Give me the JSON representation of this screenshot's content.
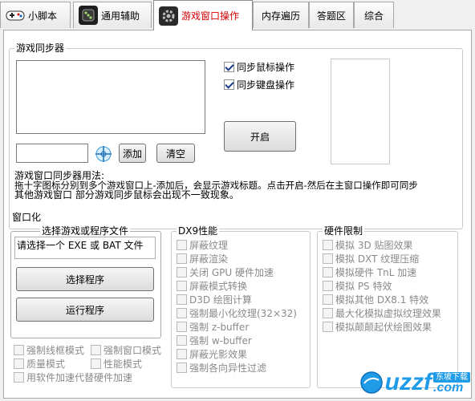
{
  "tabs": [
    {
      "label": "小脚本",
      "icon": "gamepad-icon"
    },
    {
      "label": "通用辅助",
      "icon": "dice-icon"
    },
    {
      "label": "游戏窗口操作",
      "icon": "gear-icon",
      "active": true
    },
    {
      "label": "内存遍历"
    },
    {
      "label": "答题区"
    },
    {
      "label": "综合"
    }
  ],
  "sync": {
    "title": "游戏同步器",
    "mouse_sync": "同步鼠标操作",
    "keyboard_sync": "同步键盘操作",
    "start": "开启",
    "add": "添加",
    "clear": "清空",
    "help_lines": [
      "游戏窗口同步器用法:",
      "拖十字图标分别到多个游戏窗口上-添加后，会显示游戏标题。点击开启-然后在主窗口操作即可同步",
      "其他游戏窗口        部分游戏同步鼠标会出现不一致现象。"
    ]
  },
  "windowed": {
    "title": "窗口化",
    "select_title": "选择游戏或程序文件",
    "file_text": "请选择一个 EXE 或 BAT 文件",
    "select_btn": "选择程序",
    "run_btn": "运行程序",
    "options": [
      "强制线框模式",
      "强制窗口模式",
      "质量模式",
      "性能模式",
      "用软件加速代替硬件加速"
    ]
  },
  "dx9": {
    "title": "DX9性能",
    "options": [
      "屏蔽纹理",
      "屏蔽渲染",
      "关闭 GPU 硬件加速",
      "屏蔽模式转换",
      "D3D 绘图计算",
      "强制最小化纹理(32×32)",
      "强制 z-buffer",
      "强制 w-buffer",
      "屏蔽光影效果",
      "强制各向异性过滤"
    ]
  },
  "hw": {
    "title": "硬件限制",
    "options": [
      "模拟 3D 贴图效果",
      "模拟 DXT 纹理压缩",
      "模拟硬件 TnL 加速",
      "模拟 PS 特效",
      "模拟其他 DX8.1 特效",
      "最大化模拟虚拟纹理效果",
      "模拟颠颠起伏绘图效果"
    ]
  },
  "watermark": {
    "brand": "uzzf",
    "suffix": ".com",
    "tag": "东坡下载"
  },
  "colors": {
    "active_tab": "#d60000",
    "watermark": "#1f9be8"
  }
}
